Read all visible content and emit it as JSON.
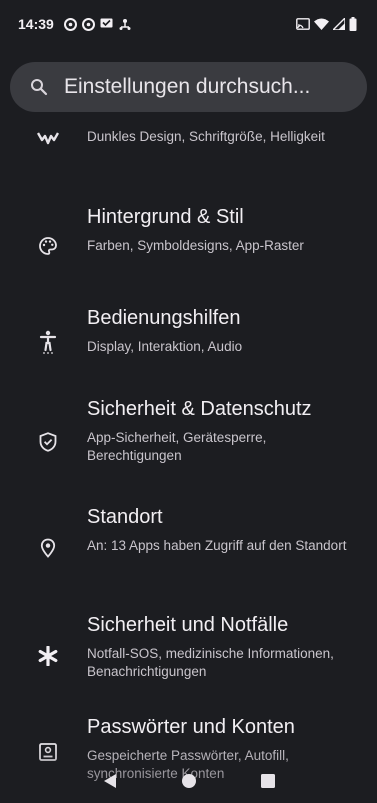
{
  "status_bar": {
    "time": "14:39"
  },
  "search": {
    "placeholder": "Einstellungen durchsuch..."
  },
  "items": [
    {
      "title": "",
      "subtitle": "Dunkles Design, Schriftgröße, Helligkeit",
      "icon": "display-icon"
    },
    {
      "title": "Hintergrund & Stil",
      "subtitle": "Farben, Symboldesigns, App-Raster",
      "icon": "palette-icon"
    },
    {
      "title": "Bedienungshilfen",
      "subtitle": "Display, Interaktion, Audio",
      "icon": "accessibility-icon"
    },
    {
      "title": "Sicherheit & Datenschutz",
      "subtitle": "App-Sicherheit, Gerätesperre, Berechtigungen",
      "icon": "shield-icon"
    },
    {
      "title": "Standort",
      "subtitle": "An: 13 Apps haben Zugriff auf den Standort",
      "icon": "location-icon"
    },
    {
      "title": "Sicherheit und Notfälle",
      "subtitle": "Notfall-SOS, medizinische Informationen, Benachrichtigungen",
      "icon": "asterisk-icon"
    },
    {
      "title": "Passwörter und Konten",
      "subtitle": "Gespeicherte Passwörter, Autofill, synchronisierte Konten",
      "icon": "account-box-icon"
    }
  ]
}
